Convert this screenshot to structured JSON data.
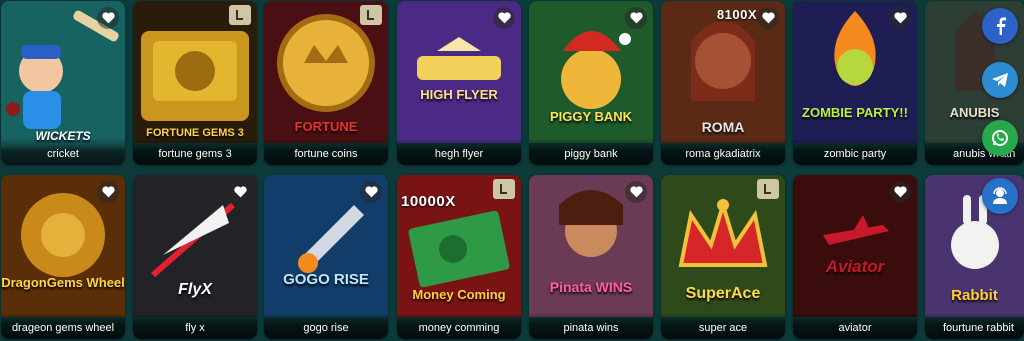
{
  "games_row1": [
    {
      "name": "cricket",
      "logo": "WICKETS",
      "bg": "#1f6b6b"
    },
    {
      "name": "fortune gems 3",
      "logo": "FORTUNE GEMS 3",
      "bg": "#3a2a12"
    },
    {
      "name": "fortune coins",
      "logo": "FORTUNE",
      "bg": "#4a0f12"
    },
    {
      "name": "hegh flyer",
      "logo": "HIGH FLYER",
      "bg": "#4b2a85"
    },
    {
      "name": "piggy bank",
      "logo": "PIGGY BANK",
      "bg": "#1e5a2a"
    },
    {
      "name": "roma gkadiatrix",
      "logo": "ROMA",
      "badge_text": "8100X",
      "bg": "#5a2a14"
    },
    {
      "name": "zombic party",
      "logo": "ZOMBIE PARTY!!",
      "bg": "#1e1e55"
    },
    {
      "name": "anubis wrath",
      "logo": "ANUBIS",
      "bg": "#2d3e35"
    }
  ],
  "games_row2": [
    {
      "name": "drageon gems wheel",
      "logo": "DragonGems Wheel",
      "bg": "#5a2e08"
    },
    {
      "name": "fly x",
      "logo": "FlyX",
      "bg": "#222227"
    },
    {
      "name": "gogo rise",
      "logo": "GOGO RISE",
      "bg": "#123d6b"
    },
    {
      "name": "money comming",
      "logo": "Money Coming",
      "badge_text": "10000X",
      "bg": "#7a1414"
    },
    {
      "name": "pinata wins",
      "logo": "Pinata WINS",
      "bg": "#6b3a55"
    },
    {
      "name": "super ace",
      "logo": "SuperAce",
      "bg": "#2f4a1a"
    },
    {
      "name": "aviator",
      "logo": "Aviator",
      "bg": "#3a0c0c"
    },
    {
      "name": "fourtune rabbit",
      "logo": "Rabbit",
      "bg": "#4a3470"
    }
  ],
  "social": [
    {
      "icon": "facebook-icon",
      "color": "#2d62c9"
    },
    {
      "icon": "telegram-icon",
      "color": "#2c8cd3"
    },
    {
      "icon": "whatsapp-icon",
      "color": "#27a84a"
    },
    {
      "icon": "support-agent-icon",
      "color": "#2672c9"
    }
  ]
}
